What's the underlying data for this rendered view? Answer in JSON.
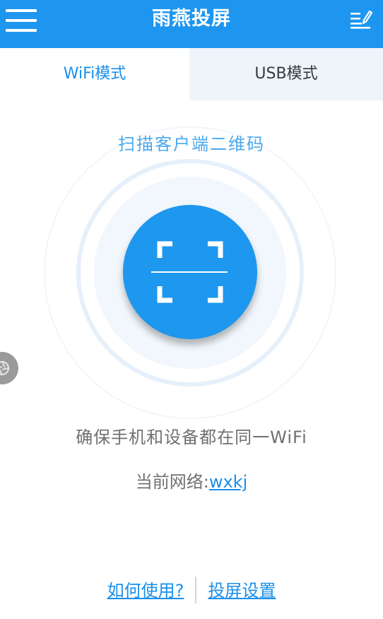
{
  "header": {
    "title": "雨燕投屏",
    "menu_icon": "hamburger-menu-icon",
    "edit_icon": "edit-list-icon"
  },
  "tabs": [
    {
      "label": "WiFi模式",
      "active": true
    },
    {
      "label": "USB模式",
      "active": false
    }
  ],
  "scan": {
    "label": "扫描客户端二维码",
    "icon": "qr-scan-icon"
  },
  "info": {
    "hint": "确保手机和设备都在同一WiFi",
    "network_prefix": "当前网络:",
    "network_name": "wxkj"
  },
  "footer": {
    "how_to_use": "如何使用?",
    "settings": "投屏设置"
  },
  "colors": {
    "primary": "#1e96f0",
    "tab_inactive_bg": "#eff4fa",
    "text_gray": "#707070"
  }
}
